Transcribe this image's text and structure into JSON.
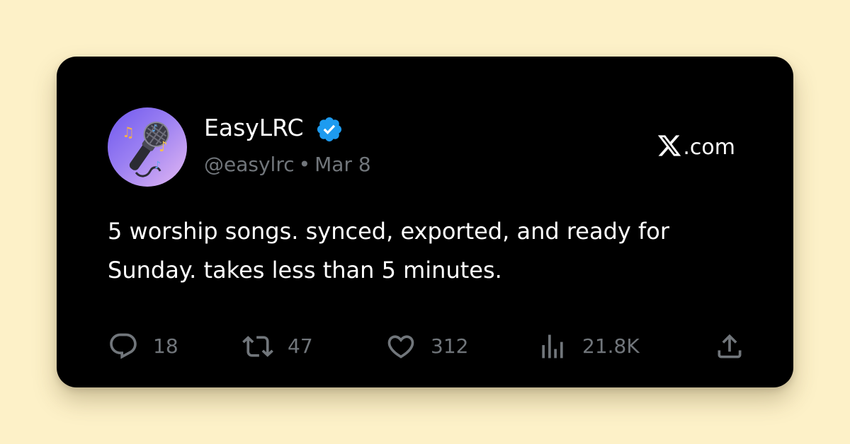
{
  "tweet": {
    "display_name": "EasyLRC",
    "handle": "@easylrc",
    "separator": "•",
    "date": "Mar 8",
    "text": "5 worship songs. synced, exported, and ready for Sunday. takes less than 5 minutes.",
    "verified": true
  },
  "brand": {
    "domain": ".com",
    "logo_icon": "x-logo-icon"
  },
  "actions": {
    "replies": "18",
    "reposts": "47",
    "likes": "312",
    "views": "21.8K"
  },
  "icons": {
    "avatar": "karaoke-microphone-icon",
    "verified": "verified-badge-icon",
    "reply": "reply-icon",
    "repost": "repost-icon",
    "like": "heart-icon",
    "views": "views-icon",
    "share": "share-icon"
  },
  "colors": {
    "page_background": "#fdf1c8",
    "card_background": "#000000",
    "primary_text": "#ffffff",
    "secondary_text": "#71767b",
    "verified_blue": "#1d9bf0",
    "avatar_gradient_start": "#6f58ee",
    "avatar_gradient_end": "#e3b8f3"
  }
}
